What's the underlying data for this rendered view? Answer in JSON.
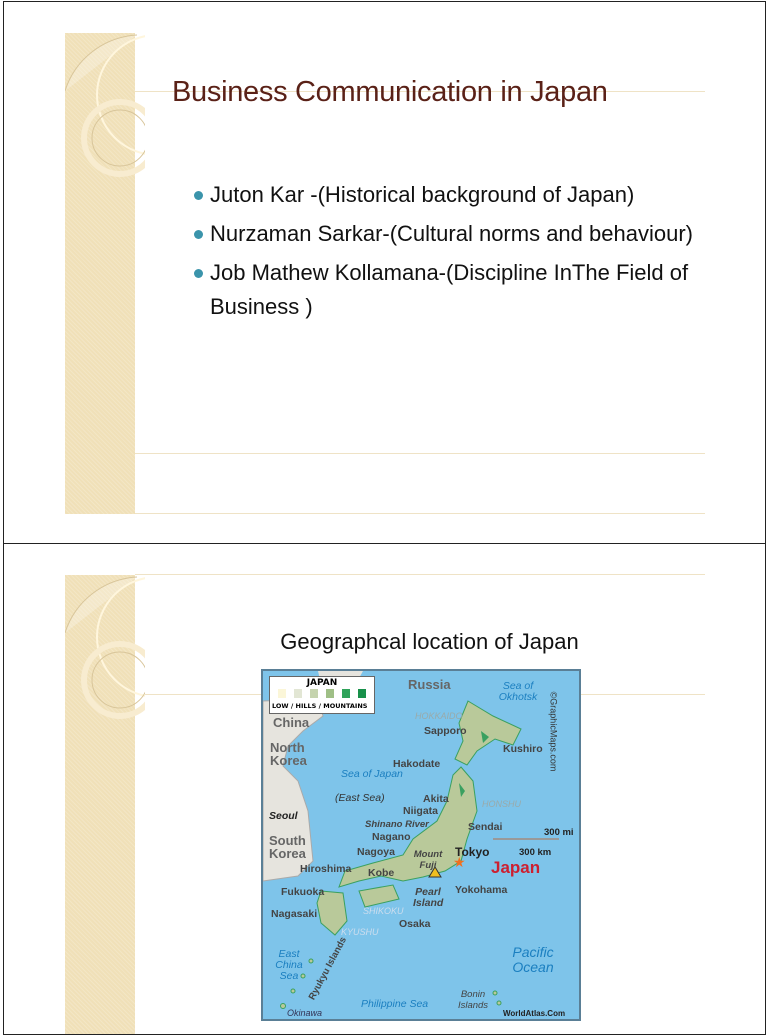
{
  "slide1": {
    "title": "Business Communication in Japan",
    "bullets": [
      "Juton Kar -(Historical background of Japan)",
      "Nurzaman Sarkar-(Cultural norms and behaviour)",
      "Job Mathew Kollamana-(Discipline InThe Field of Business )"
    ],
    "bullet_color": "#3b94ab",
    "title_color": "#5a2117"
  },
  "slide2": {
    "title": "Geographcal location of Japan",
    "map": {
      "legend_title": "JAPAN",
      "legend_label": "LOW / HILLS / MOUNTAINS",
      "copyright": "©GraphicMaps.com",
      "credit": "WorldAtlas.Com",
      "labels": {
        "russia": "Russia",
        "sea_okhotsk": "Sea of Okhotsk",
        "hokkaido": "HOKKAIDO",
        "sapporo": "Sapporo",
        "kushiro": "Kushiro",
        "hakodate": "Hakodate",
        "china": "China",
        "north_korea": "North Korea",
        "sea_japan": "Sea of Japan",
        "east_sea": "(East Sea)",
        "akita": "Akita",
        "honshu": "HONSHU",
        "niigata": "Niigata",
        "shinano": "Shinano River",
        "sendai": "Sendai",
        "nagano": "Nagano",
        "mi": "300 mi",
        "km": "300 km",
        "tokyo": "Tokyo",
        "nagoya": "Nagoya",
        "fuji": "Mount Fuji",
        "japan": "Japan",
        "hiroshima": "Hiroshima",
        "kobe": "Kobe",
        "fukuoka": "Fukuoka",
        "yokohama": "Yokohama",
        "pearl": "Pearl Island",
        "seoul": "Seoul",
        "south_korea": "South Korea",
        "nagasaki": "Nagasaki",
        "shikoku": "SHIKOKU",
        "osaka": "Osaka",
        "kyushu": "KYUSHU",
        "pacific": "Pacific Ocean",
        "east_china": "East China Sea",
        "ryukyu": "Ryukyu Islands",
        "philippine": "Philippine Sea",
        "bonin": "Bonin Islands",
        "okinawa": "Okinawa"
      }
    }
  }
}
